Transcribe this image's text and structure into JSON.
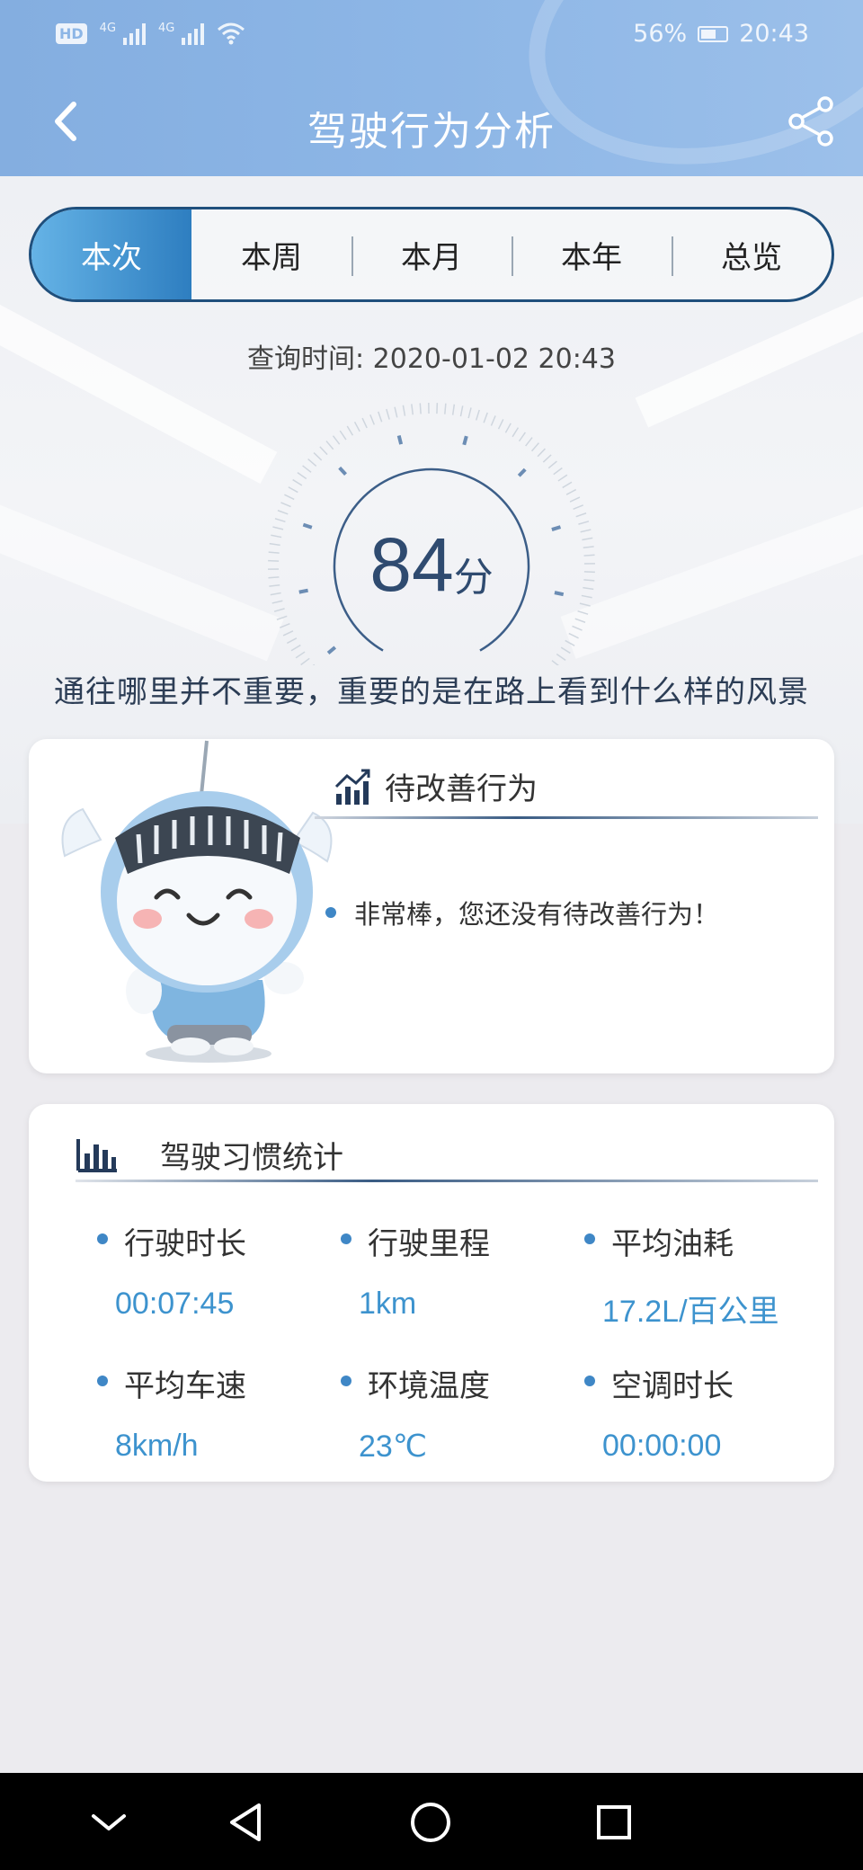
{
  "status_bar": {
    "badge": "HD",
    "net1": "4G",
    "net2": "4G",
    "battery": "56%",
    "time": "20:43"
  },
  "header": {
    "title": "驾驶行为分析",
    "back_icon": "chevron-left-icon",
    "share_icon": "share-icon"
  },
  "tabs": [
    {
      "label": "本次",
      "active": true
    },
    {
      "label": "本周",
      "active": false
    },
    {
      "label": "本月",
      "active": false
    },
    {
      "label": "本年",
      "active": false
    },
    {
      "label": "总览",
      "active": false
    }
  ],
  "query_time": "查询时间: 2020-01-02 20:43",
  "score": {
    "value": "84",
    "unit": "分"
  },
  "motto": "通往哪里并不重要，重要的是在路上看到什么样的风景",
  "improve_card": {
    "title": "待改善行为",
    "icon": "chart-trend-icon",
    "message": "非常棒，您还没有待改善行为！"
  },
  "habits_card": {
    "title": "驾驶习惯统计",
    "icon": "bar-chart-icon",
    "stats": [
      {
        "label": "行驶时长",
        "value": "00:07:45"
      },
      {
        "label": "行驶里程",
        "value": "1km"
      },
      {
        "label": "平均油耗",
        "value": "17.2L/百公里"
      },
      {
        "label": "平均车速",
        "value": "8km/h"
      },
      {
        "label": "环境温度",
        "value": "23℃"
      },
      {
        "label": "空调时长",
        "value": "00:00:00"
      }
    ]
  },
  "colors": {
    "header": "#8db6e6",
    "accent": "#3d93ce",
    "tab_active_start": "#65b3e6",
    "tab_active_end": "#2e7ec0",
    "score": "#2f4b70"
  }
}
